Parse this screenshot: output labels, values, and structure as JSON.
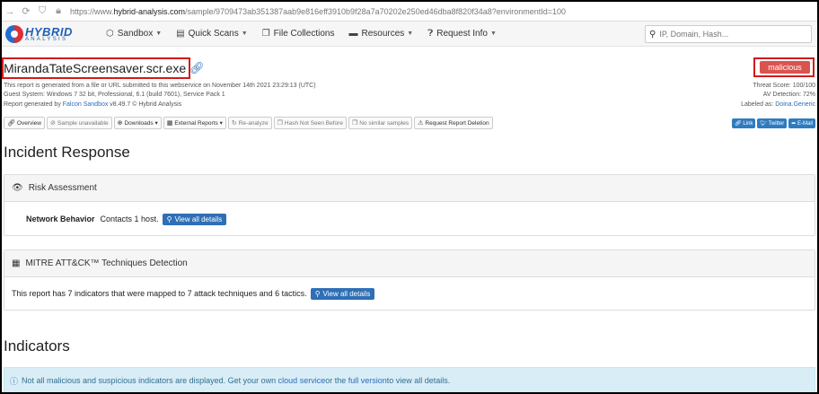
{
  "browser": {
    "url_prefix": "https://www.",
    "url_host": "hybrid-analysis.com",
    "url_path": "/sample/9709473ab351387aab9e816eff3910b9f28a7a70202e250ed46dba8f820f34a8?environmentId=100"
  },
  "header": {
    "logo_line1": "HYBRID",
    "logo_line2": "ANALYSIS",
    "nav": [
      {
        "label": "Sandbox",
        "icon": "cube-icon",
        "dropdown": true
      },
      {
        "label": "Quick Scans",
        "icon": "file-icon",
        "dropdown": true
      },
      {
        "label": "File Collections",
        "icon": "files-icon",
        "dropdown": false
      },
      {
        "label": "Resources",
        "icon": "folder-icon",
        "dropdown": true
      },
      {
        "label": "Request Info",
        "icon": "question-icon",
        "dropdown": true
      }
    ],
    "search_placeholder": "IP, Domain, Hash..."
  },
  "report": {
    "filename": "MirandaTateScreensaver.scr.exe",
    "meta_line1": "This report is generated from a file or URL submitted to this webservice on November 14th 2021 23:29:13 (UTC)",
    "meta_line2": "Guest System: Windows 7 32 bit, Professional, 6.1 (build 7601), Service Pack 1",
    "meta_line3_prefix": "Report generated by ",
    "meta_line3_link": "Falcon Sandbox",
    "meta_line3_suffix": " v8.49.7 © Hybrid Analysis",
    "verdict": "malicious",
    "threat_score": "Threat Score: 100/100",
    "av_detection": "AV Detection: 72%",
    "labeled_as_prefix": "Labeled as: ",
    "labeled_as_link": "Doina.Generic",
    "toolbar": [
      {
        "label": "Overview",
        "icon": "link-icon"
      },
      {
        "label": "Sample unavailable",
        "icon": "ban-icon"
      },
      {
        "label": "Downloads",
        "icon": "download-icon",
        "dropdown": true
      },
      {
        "label": "External Reports",
        "icon": "report-icon",
        "dropdown": true
      },
      {
        "label": "Re-analyze",
        "icon": "refresh-icon"
      },
      {
        "label": "Hash Not Seen Before",
        "icon": "copy-icon"
      },
      {
        "label": "No similar samples",
        "icon": "copy-icon"
      },
      {
        "label": "Request Report Deletion",
        "icon": "warning-icon"
      }
    ],
    "share": [
      "Link",
      "Twitter",
      "E-Mail"
    ]
  },
  "incident": {
    "title": "Incident Response",
    "risk_title": "Risk Assessment",
    "network_label": "Network Behavior",
    "network_value": "Contacts 1 host.",
    "view_all_1": "View all details",
    "mitre_title": "MITRE ATT&CK™ Techniques Detection",
    "mitre_text": "This report has 7 indicators that were mapped to 7 attack techniques and 6 tactics.",
    "view_all_2": "View all details"
  },
  "indicators": {
    "title": "Indicators",
    "alert_prefix": "Not all malicious and suspicious indicators are displayed. Get your own ",
    "alert_link1": "cloud service",
    "alert_mid": " or the ",
    "alert_link2": "full version",
    "alert_suffix": " to view all details."
  }
}
